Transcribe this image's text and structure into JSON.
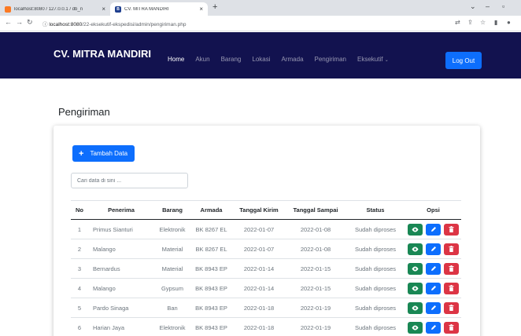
{
  "browser": {
    "tabs": [
      {
        "label": "localhost:8080 / 127.0.0.1 / db_n",
        "active": false
      },
      {
        "label": "CV. MITRA MANDIRI",
        "active": true
      }
    ],
    "url_host": "localhost:8080",
    "url_path": "/22-eksekutif-ekspedisi/admin/pengiriman.php"
  },
  "navbar": {
    "brand": "CV. MITRA MANDIRI",
    "links": [
      {
        "label": "Home",
        "active": true
      },
      {
        "label": "Akun",
        "active": false
      },
      {
        "label": "Barang",
        "active": false
      },
      {
        "label": "Lokasi",
        "active": false
      },
      {
        "label": "Armada",
        "active": false
      },
      {
        "label": "Pengiriman",
        "active": false
      },
      {
        "label": "Eksekutif",
        "active": false,
        "dropdown": true
      }
    ],
    "logout_label": "Log Out"
  },
  "page": {
    "title": "Pengiriman",
    "add_label": "Tambah Data",
    "search_placeholder": "Cari data di sini ..."
  },
  "table": {
    "headers": [
      "No",
      "Penerima",
      "Barang",
      "Armada",
      "Tanggal Kirim",
      "Tanggal Sampai",
      "Status",
      "Opsi"
    ],
    "rows": [
      [
        "1",
        "Primus Sianturi",
        "Elektronik",
        "BK 8267 EL",
        "2022-01-07",
        "2022-01-08",
        "Sudah diproses"
      ],
      [
        "2",
        "Malango",
        "Material",
        "BK 8267 EL",
        "2022-01-07",
        "2022-01-08",
        "Sudah diproses"
      ],
      [
        "3",
        "Bernardus",
        "Material",
        "BK 8943 EP",
        "2022-01-14",
        "2022-01-15",
        "Sudah diproses"
      ],
      [
        "4",
        "Malango",
        "Gypsum",
        "BK 8943 EP",
        "2022-01-14",
        "2022-01-15",
        "Sudah diproses"
      ],
      [
        "5",
        "Pardo Sinaga",
        "Ban",
        "BK 8943 EP",
        "2022-01-18",
        "2022-01-19",
        "Sudah diproses"
      ],
      [
        "6",
        "Harian Jaya",
        "Elektronik",
        "BK 8943 EP",
        "2022-01-18",
        "2022-01-19",
        "Sudah diproses"
      ]
    ]
  },
  "colors": {
    "navbar": "#12124f",
    "primary": "#0d6efd",
    "success": "#198754",
    "danger": "#dc3545"
  },
  "icons": [
    "eye-icon",
    "pencil-icon",
    "trash-icon",
    "plus-icon",
    "info-icon"
  ]
}
